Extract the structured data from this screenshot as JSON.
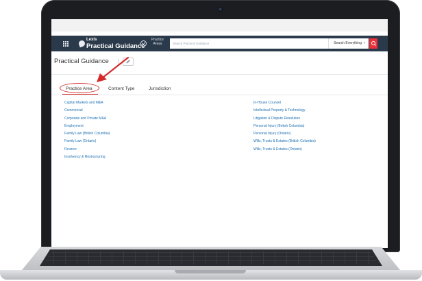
{
  "header": {
    "brand_top": "Lexis",
    "brand_main": "Practical Guidance",
    "practice_areas_label": "Practice Areas",
    "search_placeholder": "Search Practical Guidance",
    "search_scope": "Search Everything",
    "accent_color": "#e8323c",
    "navbar_color": "#2b3a4a"
  },
  "page": {
    "title": "Practical Guidance"
  },
  "tabs": [
    {
      "label": "Practice Area",
      "active": true
    },
    {
      "label": "Content Type",
      "active": false
    },
    {
      "label": "Jurisdiction",
      "active": false
    }
  ],
  "practice_areas": {
    "left": [
      "Capital Markets and M&A",
      "Commercial",
      "Corporate and Private M&A",
      "Employment",
      "Family Law (British Columbia)",
      "Family Law (Ontario)",
      "Finance",
      "Insolvency & Restructuring"
    ],
    "right": [
      "In-House Counsel",
      "Intellectual Property & Technology",
      "Litigation & Dispute Resolution",
      "Personal Injury (British Columbia)",
      "Personal Injury (Ontario)",
      "Wills, Trusts & Estates (British Columbia)",
      "Wills, Trusts & Estates (Ontario)"
    ]
  },
  "colors": {
    "link": "#1b6fb4",
    "annotation": "#d42a2a"
  }
}
